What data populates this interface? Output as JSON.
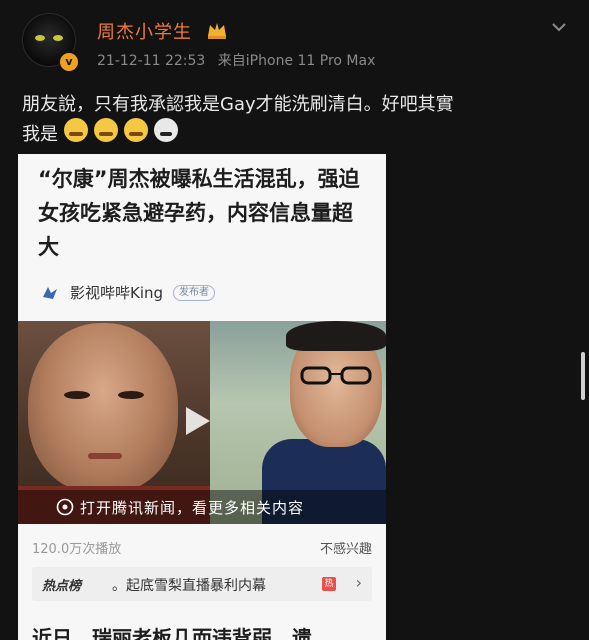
{
  "post": {
    "author": "周杰小学生",
    "time": "21-12-11 22:53",
    "source": "来自iPhone 11 Pro Max",
    "text_line1": "朋友說，只有我承認我是Gay才能洗刷清白。好吧其實",
    "text_line2": "我是"
  },
  "card": {
    "headline": "“尔康”周杰被曝私生活混乱，强迫女孩吃紧急避孕药，内容信息量超大",
    "source_name": "影视哔哔King",
    "source_tag": "发布者",
    "video_caption": "打开腾讯新闻，看更多相关内容",
    "views": "120.0万次播放",
    "not_interested": "不感兴趣",
    "hot_label": "热点榜",
    "hot_text": "。起底雪梨直播暴利内幕",
    "hot_badge": "热",
    "next_line": "近日，瑞丽老板几而违背弱、遗"
  },
  "colors": {
    "username": "#f07a3a",
    "background": "#121212",
    "card": "#f7f7f7"
  }
}
